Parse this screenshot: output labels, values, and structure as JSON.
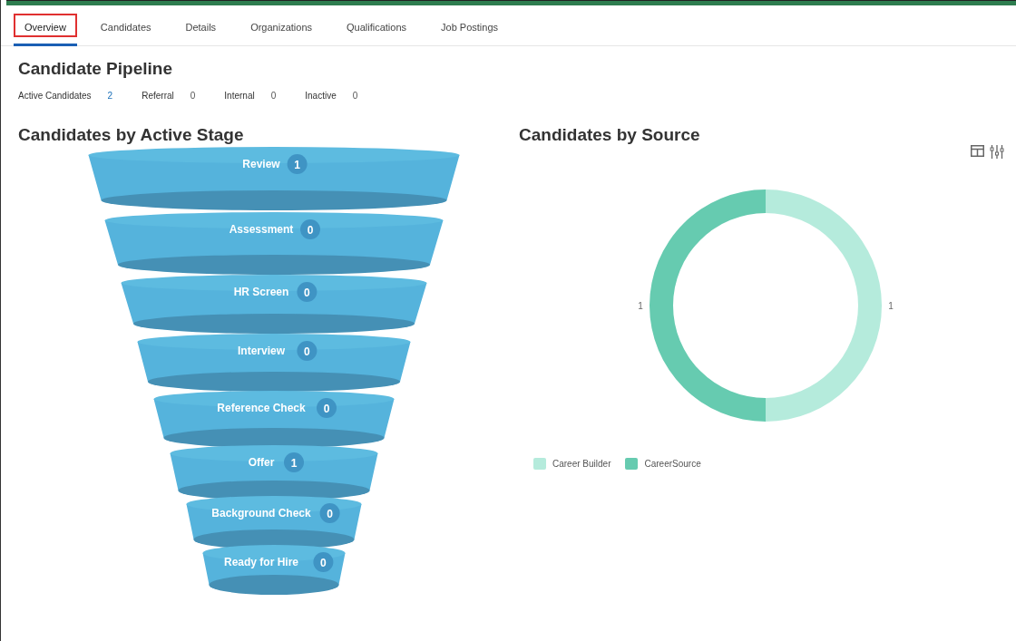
{
  "tabs": [
    {
      "label": "Overview",
      "selected": true
    },
    {
      "label": "Candidates",
      "selected": false
    },
    {
      "label": "Details",
      "selected": false
    },
    {
      "label": "Organizations",
      "selected": false
    },
    {
      "label": "Qualifications",
      "selected": false
    },
    {
      "label": "Job Postings",
      "selected": false
    }
  ],
  "pipeline": {
    "title": "Candidate Pipeline",
    "stats": [
      {
        "label": "Active Candidates",
        "value": "2",
        "kind": "link"
      },
      {
        "label": "Referral",
        "value": "0",
        "kind": "plain"
      },
      {
        "label": "Internal",
        "value": "0",
        "kind": "plain"
      },
      {
        "label": "Inactive",
        "value": "0",
        "kind": "plain"
      }
    ]
  },
  "stage_chart": {
    "title": "Candidates by Active Stage",
    "stages": [
      {
        "label": "Review",
        "count": "1"
      },
      {
        "label": "Assessment",
        "count": "0"
      },
      {
        "label": "HR Screen",
        "count": "0"
      },
      {
        "label": "Interview",
        "count": "0"
      },
      {
        "label": "Reference Check",
        "count": "0"
      },
      {
        "label": "Offer",
        "count": "1"
      },
      {
        "label": "Background Check",
        "count": "0"
      },
      {
        "label": "Ready for Hire",
        "count": "0"
      }
    ]
  },
  "source_chart": {
    "title": "Candidates by Source",
    "chart_data": {
      "type": "donut",
      "categories": [
        "Career Builder",
        "CareerSource"
      ],
      "series": [
        {
          "values": [
            1,
            1
          ],
          "colors": [
            "#b5ebdc",
            "#66cbb0"
          ]
        }
      ],
      "data_labels": true
    }
  }
}
